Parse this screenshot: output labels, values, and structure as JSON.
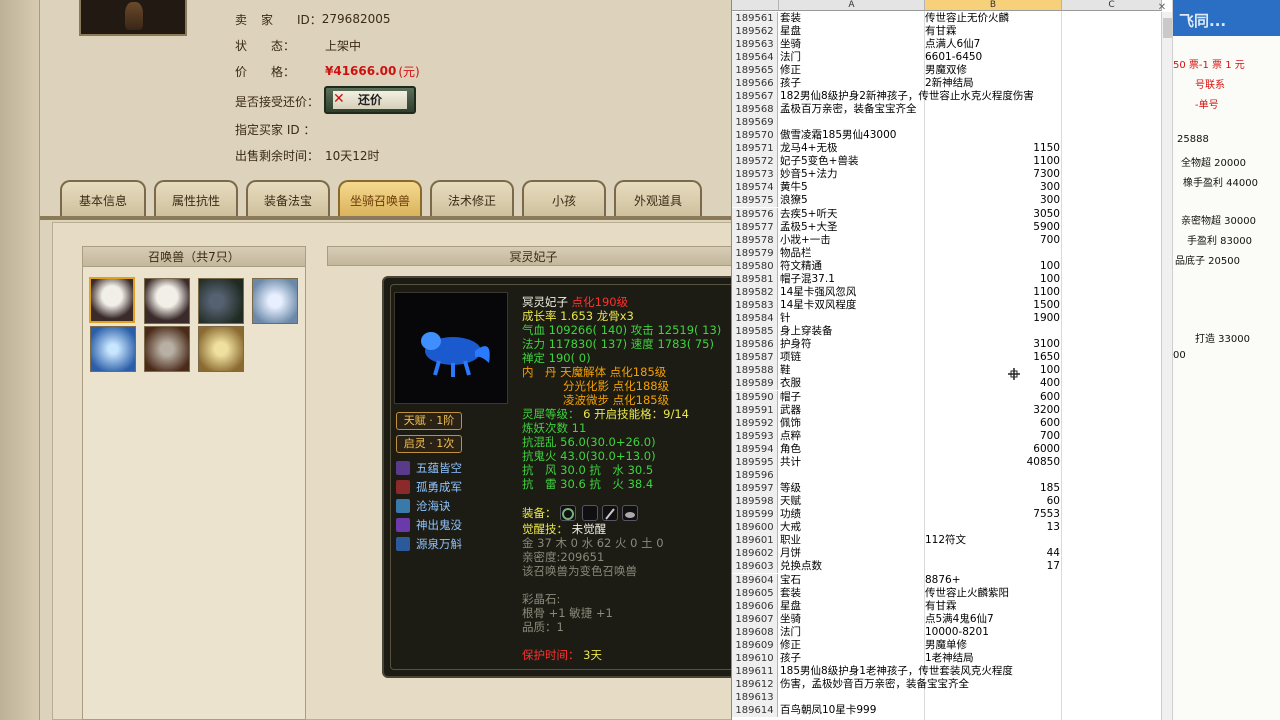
{
  "game": {
    "seller_label": "卖　家",
    "seller_id_label": "ID：",
    "seller_id": "279682005",
    "status_label": "状　　态：",
    "status_value": "上架中",
    "price_label": "价　　格：",
    "price_value": "¥41666.00",
    "price_unit": "(元)",
    "counter_label": "是否接受还价：",
    "counter_button": "还价",
    "buyer_label": "指定买家 ID ：",
    "time_label": "出售剩余时间：",
    "time_value": "10天12时",
    "tabs": [
      "基本信息",
      "属性抗性",
      "装备法宝",
      "坐骑召唤兽",
      "法术修正",
      "小孩",
      "外观道具"
    ],
    "active_tab": 3,
    "pet_panel_title": "召唤兽（共7只）",
    "detail_title": "冥灵妃子",
    "pet": {
      "name": "冥灵妃子",
      "level": "点化190级",
      "growth": "成长率 1.653 龙骨x3",
      "hp_label": "气血",
      "hp": "109266( 140)",
      "atk_label": "攻击",
      "atk": "12519( 13)",
      "mp_label": "法力",
      "mp": "117830( 137)",
      "spd_label": "速度",
      "spd": "1783( 75)",
      "zen_label": "禅定",
      "zen": "190( 0)",
      "inner_label": "内　丹",
      "inner1": "天魔解体 点化185级",
      "inner2": "分光化影 点化188级",
      "inner3": "凌波微步 点化185级",
      "spirit_label": "灵犀等级：",
      "spirit": "6 开启技能格：9/14",
      "refine_label": "炼妖次数",
      "refine": "11",
      "res1_label": "抗混乱",
      "res1": "56.0(30.0+26.0)",
      "res2_label": "抗鬼火",
      "res2": "43.0(30.0+13.0)",
      "res3": "抗　风 30.0 抗　水 30.5",
      "res4": "抗　雷 30.6 抗　火 38.4",
      "equip_label": "装备：",
      "awaken_label": "觉醒技：",
      "awaken_value": "未觉醒",
      "elements": "金 37 木 0 水 62 火 0 土 0",
      "intimacy": "亲密度:209651",
      "color_note": "该召唤兽为变色召唤兽",
      "crystal_title": "彩晶石:",
      "crystal1": "根骨 +1 敏捷 +1",
      "crystal2": "品质：1",
      "protect_label": "保护时间：",
      "protect_value": "3天",
      "badge1": "天赋 · 1阶",
      "badge2": "启灵 · 1次",
      "skills": [
        "五蕴皆空",
        "孤勇成军",
        "沧海诀",
        "神出鬼没",
        "源泉万斛"
      ]
    }
  },
  "excel": {
    "columns": [
      "A",
      "B",
      "C"
    ],
    "rows": [
      {
        "n": "189561",
        "a": "套装",
        "b": "传世容止无价火麟"
      },
      {
        "n": "189562",
        "a": "星盘",
        "b": "有甘霖"
      },
      {
        "n": "189563",
        "a": "坐骑",
        "b": "点满人6仙7"
      },
      {
        "n": "189564",
        "a": "法门",
        "b": "6601-6450"
      },
      {
        "n": "189565",
        "a": "修正",
        "b": "男魔双修"
      },
      {
        "n": "189566",
        "a": "孩子",
        "b": "2新神结局"
      },
      {
        "n": "189567",
        "a": "182男仙8级护身2新神孩子，传世容止水克火程度伤害",
        "b": ""
      },
      {
        "n": "189568",
        "a": "孟极百万亲密，装备宝宝齐全",
        "b": ""
      },
      {
        "n": "189569",
        "a": "",
        "b": ""
      },
      {
        "n": "189570",
        "a": "傲雪凌霜185男仙43000",
        "b": ""
      },
      {
        "n": "189571",
        "a": "龙马4+无极",
        "v": "1150"
      },
      {
        "n": "189572",
        "a": "妃子5变色+兽装",
        "v": "1100"
      },
      {
        "n": "189573",
        "a": "妙音5+法力",
        "v": "7300"
      },
      {
        "n": "189574",
        "a": "黄牛5",
        "v": "300"
      },
      {
        "n": "189575",
        "a": "浪獠5",
        "v": "300"
      },
      {
        "n": "189576",
        "a": "去疾5+听天",
        "v": "3050"
      },
      {
        "n": "189577",
        "a": "孟极5+大圣",
        "v": "5900"
      },
      {
        "n": "189578",
        "a": "小戕+一击",
        "v": "700"
      },
      {
        "n": "189579",
        "a": "物品栏",
        "b": ""
      },
      {
        "n": "189580",
        "a": "符文精通",
        "v": "100"
      },
      {
        "n": "189581",
        "a": "帽子混37.1",
        "v": "100"
      },
      {
        "n": "189582",
        "a": "14星卡强风忽风",
        "v": "1100"
      },
      {
        "n": "189583",
        "a": "14星卡双风程度",
        "v": "1500"
      },
      {
        "n": "189584",
        "a": "针",
        "v": "1900"
      },
      {
        "n": "189585",
        "a": "身上穿装备",
        "b": ""
      },
      {
        "n": "189586",
        "a": "护身符",
        "v": "3100"
      },
      {
        "n": "189587",
        "a": "项链",
        "v": "1650"
      },
      {
        "n": "189588",
        "a": "鞋",
        "v": "100"
      },
      {
        "n": "189589",
        "a": "衣服",
        "v": "400"
      },
      {
        "n": "189590",
        "a": "帽子",
        "v": "600"
      },
      {
        "n": "189591",
        "a": "武器",
        "v": "3200"
      },
      {
        "n": "189592",
        "a": "佩饰",
        "v": "600"
      },
      {
        "n": "189593",
        "a": "点粹",
        "v": "700"
      },
      {
        "n": "189594",
        "a": "角色",
        "v": "6000"
      },
      {
        "n": "189595",
        "a": "共计",
        "v": "40850"
      },
      {
        "n": "189596",
        "a": "",
        "b": ""
      },
      {
        "n": "189597",
        "a": "等级",
        "v": "185"
      },
      {
        "n": "189598",
        "a": "天赋",
        "v": "60"
      },
      {
        "n": "189599",
        "a": "功绩",
        "v": "7553"
      },
      {
        "n": "189600",
        "a": "大戒",
        "v": "13"
      },
      {
        "n": "189601",
        "a": "职业",
        "b": "112符文"
      },
      {
        "n": "189602",
        "a": "月饼",
        "v": "44"
      },
      {
        "n": "189603",
        "a": "兑换点数",
        "v": "17"
      },
      {
        "n": "189604",
        "a": "宝石",
        "b": "8876+"
      },
      {
        "n": "189605",
        "a": "套装",
        "b": "传世容止火麟紫阳"
      },
      {
        "n": "189606",
        "a": "星盘",
        "b": "有甘霖"
      },
      {
        "n": "189607",
        "a": "坐骑",
        "b": "点5满4鬼6仙7"
      },
      {
        "n": "189608",
        "a": "法门",
        "b": "10000-8201"
      },
      {
        "n": "189609",
        "a": "修正",
        "b": "男魔单修"
      },
      {
        "n": "189610",
        "a": "孩子",
        "b": "1老神结局"
      },
      {
        "n": "189611",
        "a": "185男仙8级护身1老神孩子，传世套装风克火程度",
        "b": ""
      },
      {
        "n": "189612",
        "a": "伤害，孟极妙音百万亲密，装备宝宝齐全",
        "b": ""
      },
      {
        "n": "189613",
        "a": "",
        "b": ""
      },
      {
        "n": "189614",
        "a": "百鸟朝凤10星卡999",
        "b": ""
      }
    ]
  },
  "strip": {
    "logo": "飞同...",
    "lines": [
      {
        "t": "50 票-1 票 1 元",
        "c": "red"
      },
      {
        "t": "号联系",
        "c": "red"
      },
      {
        "t": "-单号",
        "c": "red"
      },
      {
        "t": "25888",
        "c": "black"
      },
      {
        "t": "全物超 20000",
        "c": "black"
      },
      {
        "t": "橡手盈利 44000",
        "c": "black"
      },
      {
        "t": "亲密物超 30000",
        "c": "black"
      },
      {
        "t": "手盈利 83000",
        "c": "black"
      },
      {
        "t": "品底子 20500",
        "c": "black"
      },
      {
        "t": "打造 33000",
        "c": "black"
      },
      {
        "t": "00",
        "c": "black"
      }
    ]
  }
}
